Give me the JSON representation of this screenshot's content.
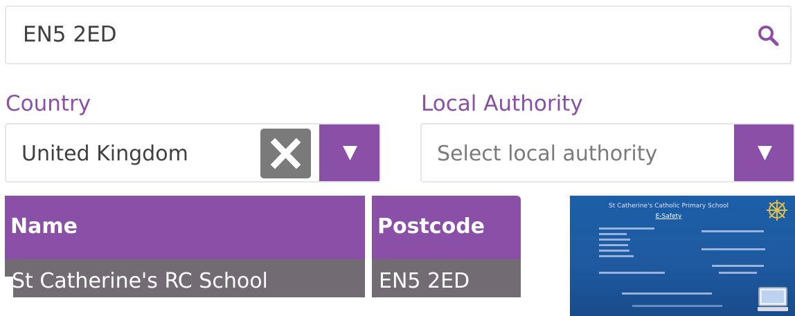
{
  "search": {
    "value": "EN5 2ED"
  },
  "filters": {
    "country": {
      "label": "Country",
      "value": "United Kingdom"
    },
    "local_authority": {
      "label": "Local Authority",
      "placeholder": "Select local authority"
    }
  },
  "table": {
    "columns": [
      "Name",
      "Postcode"
    ],
    "rows": [
      {
        "name": "St Catherine's RC School",
        "postcode": "EN5 2ED"
      }
    ]
  },
  "thumbnail": {
    "title": "St Catherine's Catholic Primary School",
    "subtitle": "E-Safety"
  },
  "colors": {
    "accent": "#8a4fa6",
    "row": "#736b73",
    "clear": "#7a7a7a"
  },
  "icons": {
    "search": "search-icon",
    "clear": "close-icon",
    "dropdown": "triangle-down-icon"
  }
}
